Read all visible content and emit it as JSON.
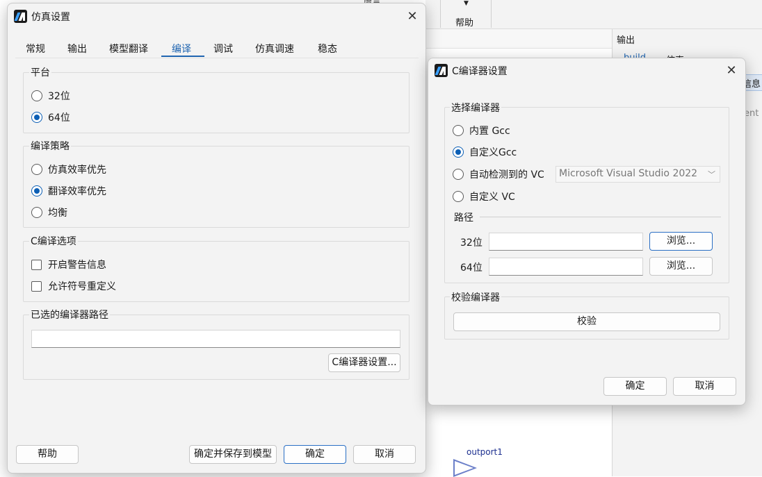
{
  "background": {
    "toolbar_help_label": "帮助",
    "partial_top_text": "语言",
    "output_panel_title": "输出",
    "output_tab_1": "build",
    "output_tab_2": "仿真",
    "output_info_tab": "信息",
    "output_partial_text": "ent",
    "outport_label": "outport1"
  },
  "sim_settings": {
    "title": "仿真设置",
    "tabs": [
      "常规",
      "输出",
      "模型翻译",
      "编译",
      "调试",
      "仿真调速",
      "稳态"
    ],
    "active_tab": "编译",
    "platform": {
      "title": "平台",
      "options": [
        "32位",
        "64位"
      ],
      "selected": "64位"
    },
    "strategy": {
      "title": "编译策略",
      "options": [
        "仿真效率优先",
        "翻译效率优先",
        "均衡"
      ],
      "selected": "翻译效率优先"
    },
    "c_options": {
      "title": "C编译选项",
      "items": [
        "开启警告信息",
        "允许符号重定义"
      ]
    },
    "compiler_path": {
      "title": "已选的编译器路径",
      "value": "",
      "settings_button": "C编译器设置..."
    },
    "buttons": {
      "help": "帮助",
      "ok_save": "确定并保存到模型",
      "ok": "确定",
      "cancel": "取消"
    }
  },
  "c_compiler": {
    "title": "C编译器设置",
    "select_group": {
      "title": "选择编译器",
      "options": [
        "内置 Gcc",
        "自定义Gcc",
        "自动检测到的 VC",
        "自定义 VC"
      ],
      "selected": "自定义Gcc",
      "vc_dropdown_value": "Microsoft Visual Studio 2022"
    },
    "path": {
      "title": "路径",
      "label_32": "32位",
      "label_64": "64位",
      "value_32": "",
      "value_64": "",
      "browse_label": "浏览..."
    },
    "verify_group": {
      "title": "校验编译器",
      "button": "校验"
    },
    "buttons": {
      "ok": "确定",
      "cancel": "取消"
    }
  }
}
